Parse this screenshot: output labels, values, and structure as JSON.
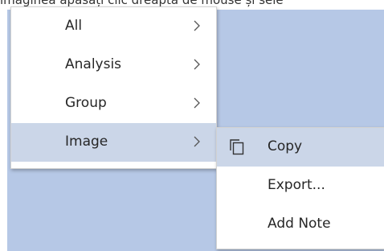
{
  "caption": "imaginea apăsați clic dreapta de mouse și sele",
  "context_menu": {
    "items": [
      {
        "label": "All",
        "submenu": true
      },
      {
        "label": "Analysis",
        "submenu": true
      },
      {
        "label": "Group",
        "submenu": true
      },
      {
        "label": "Image",
        "submenu": true,
        "highlighted": true
      }
    ]
  },
  "image_submenu": {
    "items": [
      {
        "label": "Copy",
        "icon": "copy-icon",
        "highlighted": true
      },
      {
        "label": "Export..."
      },
      {
        "label": "Add Note"
      }
    ]
  },
  "colors": {
    "canvas": "#b6c8e6",
    "menu_background": "#ffffff",
    "highlight": "#cbd6e8",
    "text": "#262626"
  }
}
